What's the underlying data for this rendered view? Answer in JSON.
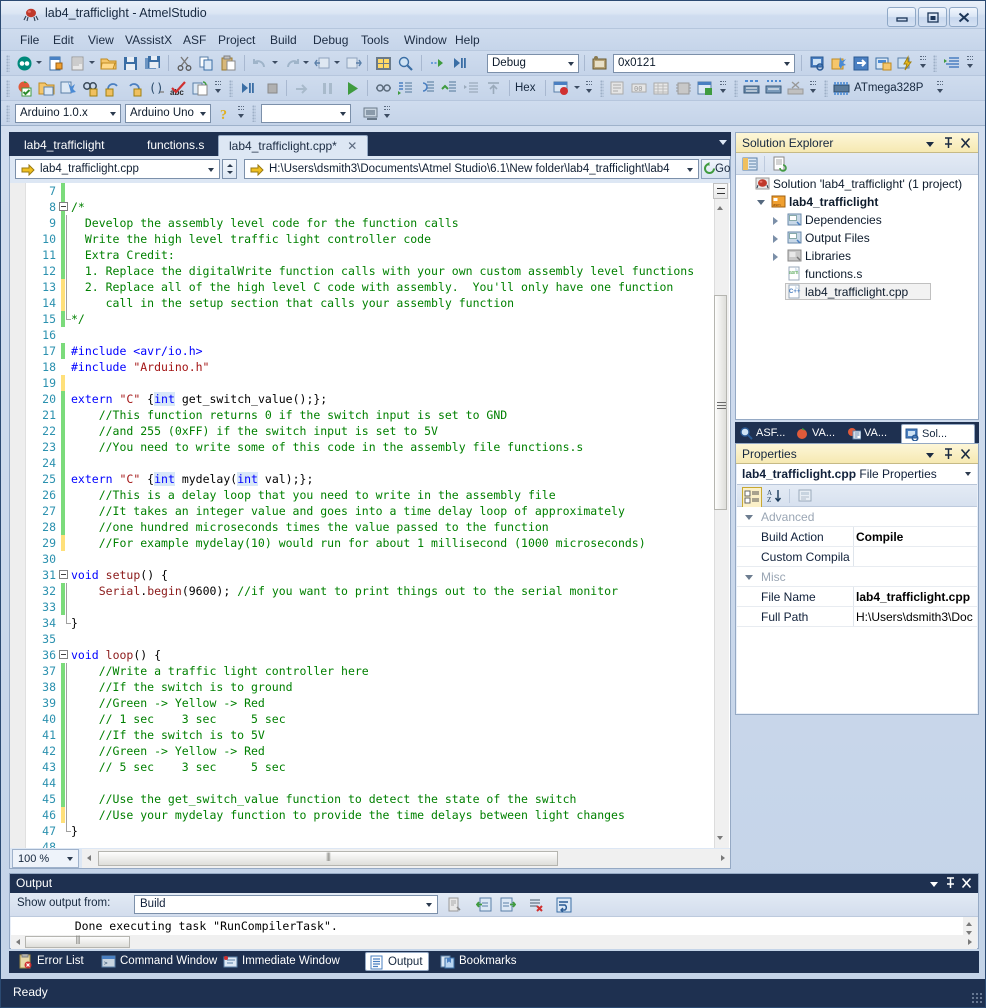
{
  "window": {
    "title": "lab4_trafficlight - AtmelStudio",
    "minimize_label": "Minimize",
    "maximize_label": "Maximize",
    "close_label": "Close"
  },
  "menubar": {
    "items": [
      "File",
      "Edit",
      "View",
      "VAssistX",
      "ASF",
      "Project",
      "Build",
      "Debug",
      "Tools",
      "Window",
      "Help"
    ]
  },
  "toolbar": {
    "debug_config": "Debug",
    "address_value": "0x0121",
    "hex_label": "Hex",
    "device_label": "ATmega328P",
    "arduino_board_version": "Arduino 1.0.x",
    "arduino_board": "Arduino Uno",
    "arduino_port": ""
  },
  "doctabs": {
    "tabs": [
      {
        "label": "lab4_trafficlight",
        "active": false,
        "closable": false
      },
      {
        "label": "functions.s",
        "active": false,
        "closable": false
      },
      {
        "label": "lab4_trafficlight.cpp*",
        "active": true,
        "closable": true
      }
    ],
    "close_glyph": "✕"
  },
  "navbar": {
    "file_combo": "lab4_trafficlight.cpp",
    "path_combo": "H:\\Users\\dsmith3\\Documents\\Atmel Studio\\6.1\\New folder\\lab4_trafficlight\\lab4",
    "go_label": "Go"
  },
  "editor": {
    "zoom": "100 %",
    "lines": [
      {
        "n": 7,
        "marker": "green",
        "fold": "",
        "tokens": []
      },
      {
        "n": 8,
        "marker": "green",
        "fold": "start",
        "tokens": [
          {
            "t": "/*",
            "c": "cmt"
          }
        ]
      },
      {
        "n": 9,
        "marker": "green",
        "fold": "bar",
        "tokens": [
          {
            "t": "  Develop the assembly level code for the function calls",
            "c": "cmt"
          }
        ]
      },
      {
        "n": 10,
        "marker": "green",
        "fold": "bar",
        "tokens": [
          {
            "t": "  Write the high level traffic light controller code",
            "c": "cmt"
          }
        ]
      },
      {
        "n": 11,
        "marker": "green",
        "fold": "bar",
        "tokens": [
          {
            "t": "  Extra Credit:",
            "c": "cmt"
          }
        ]
      },
      {
        "n": 12,
        "marker": "green",
        "fold": "bar",
        "tokens": [
          {
            "t": "  1. Replace the digitalWrite function calls with your own custom assembly level functions",
            "c": "cmt"
          }
        ]
      },
      {
        "n": 13,
        "marker": "yellow",
        "fold": "bar",
        "tokens": [
          {
            "t": "  2. Replace all of the high level C code with assembly.  You'll only have one function",
            "c": "cmt"
          }
        ]
      },
      {
        "n": 14,
        "marker": "yellow",
        "fold": "bar",
        "tokens": [
          {
            "t": "     call in the setup section that calls your assembly function",
            "c": "cmt"
          }
        ]
      },
      {
        "n": 15,
        "marker": "green",
        "fold": "end",
        "tokens": [
          {
            "t": "*/",
            "c": "cmt"
          }
        ]
      },
      {
        "n": 16,
        "marker": "",
        "fold": "",
        "tokens": []
      },
      {
        "n": 17,
        "marker": "green",
        "fold": "",
        "tokens": [
          {
            "t": "#include <avr/io.h>",
            "c": "pp"
          }
        ]
      },
      {
        "n": 18,
        "marker": "",
        "fold": "",
        "tokens": [
          {
            "t": "#include ",
            "c": "pp"
          },
          {
            "t": "\"Arduino.h\"",
            "c": "str"
          }
        ]
      },
      {
        "n": 19,
        "marker": "yellow",
        "fold": "",
        "tokens": []
      },
      {
        "n": 20,
        "marker": "green",
        "fold": "",
        "tokens": [
          {
            "t": "extern ",
            "c": "kw"
          },
          {
            "t": "\"C\"",
            "c": "str"
          },
          {
            "t": " {",
            "c": "pln"
          },
          {
            "t": "int",
            "c": "kw",
            "hl": true
          },
          {
            "t": " get_switch_value();};",
            "c": "pln"
          }
        ]
      },
      {
        "n": 21,
        "marker": "green",
        "fold": "",
        "tokens": [
          {
            "t": "    //This function returns 0 if the switch input is set to GND",
            "c": "cmt"
          }
        ]
      },
      {
        "n": 22,
        "marker": "green",
        "fold": "",
        "tokens": [
          {
            "t": "    //and 255 (0xFF) if the switch input is set to 5V",
            "c": "cmt"
          }
        ]
      },
      {
        "n": 23,
        "marker": "green",
        "fold": "",
        "tokens": [
          {
            "t": "    //You need to write some of this code in the assembly file functions.s",
            "c": "cmt"
          }
        ]
      },
      {
        "n": 24,
        "marker": "green",
        "fold": "",
        "tokens": []
      },
      {
        "n": 25,
        "marker": "green",
        "fold": "",
        "tokens": [
          {
            "t": "extern ",
            "c": "kw"
          },
          {
            "t": "\"C\"",
            "c": "str"
          },
          {
            "t": " {",
            "c": "pln"
          },
          {
            "t": "int",
            "c": "kw",
            "hl": true
          },
          {
            "t": " mydelay(",
            "c": "pln"
          },
          {
            "t": "int",
            "c": "kw",
            "hl": true
          },
          {
            "t": " val);};",
            "c": "pln"
          }
        ]
      },
      {
        "n": 26,
        "marker": "green",
        "fold": "",
        "tokens": [
          {
            "t": "    //This is a delay loop that you need to write in the assembly file",
            "c": "cmt"
          }
        ]
      },
      {
        "n": 27,
        "marker": "green",
        "fold": "",
        "tokens": [
          {
            "t": "    //It takes an integer value and goes into a time delay loop of approximately",
            "c": "cmt"
          }
        ]
      },
      {
        "n": 28,
        "marker": "green",
        "fold": "",
        "tokens": [
          {
            "t": "    //one hundred microseconds times the value passed to the function",
            "c": "cmt"
          }
        ]
      },
      {
        "n": 29,
        "marker": "yellow",
        "fold": "",
        "tokens": [
          {
            "t": "    //For example mydelay(10) would run for about 1 millisecond (1000 microseconds)",
            "c": "cmt"
          }
        ]
      },
      {
        "n": 30,
        "marker": "",
        "fold": "",
        "tokens": []
      },
      {
        "n": 31,
        "marker": "",
        "fold": "start",
        "tokens": [
          {
            "t": "void",
            "c": "kw"
          },
          {
            "t": " ",
            "c": "pln"
          },
          {
            "t": "setup",
            "c": "fn"
          },
          {
            "t": "() {",
            "c": "pln"
          }
        ]
      },
      {
        "n": 32,
        "marker": "green",
        "fold": "bar",
        "tokens": [
          {
            "t": "    ",
            "c": "pln"
          },
          {
            "t": "Serial",
            "c": "fn"
          },
          {
            "t": ".",
            "c": "pln"
          },
          {
            "t": "begin",
            "c": "fn"
          },
          {
            "t": "(9600); ",
            "c": "pln"
          },
          {
            "t": "//if you want to print things out to the serial monitor",
            "c": "cmt"
          }
        ]
      },
      {
        "n": 33,
        "marker": "green",
        "fold": "bar",
        "tokens": []
      },
      {
        "n": 34,
        "marker": "",
        "fold": "end",
        "tokens": [
          {
            "t": "}",
            "c": "pln"
          }
        ]
      },
      {
        "n": 35,
        "marker": "",
        "fold": "",
        "tokens": []
      },
      {
        "n": 36,
        "marker": "",
        "fold": "start",
        "tokens": [
          {
            "t": "void",
            "c": "kw"
          },
          {
            "t": " ",
            "c": "pln"
          },
          {
            "t": "loop",
            "c": "fn"
          },
          {
            "t": "() {",
            "c": "pln"
          }
        ]
      },
      {
        "n": 37,
        "marker": "green",
        "fold": "bar",
        "tokens": [
          {
            "t": "    //Write a traffic light controller here",
            "c": "cmt"
          }
        ]
      },
      {
        "n": 38,
        "marker": "green",
        "fold": "bar",
        "tokens": [
          {
            "t": "    //If the switch is to ground",
            "c": "cmt"
          }
        ]
      },
      {
        "n": 39,
        "marker": "green",
        "fold": "bar",
        "tokens": [
          {
            "t": "    //Green -> Yellow -> Red",
            "c": "cmt"
          }
        ]
      },
      {
        "n": 40,
        "marker": "green",
        "fold": "bar",
        "tokens": [
          {
            "t": "    // 1 sec    3 sec     5 sec",
            "c": "cmt"
          }
        ]
      },
      {
        "n": 41,
        "marker": "green",
        "fold": "bar",
        "tokens": [
          {
            "t": "    //If the switch is to 5V",
            "c": "cmt"
          }
        ]
      },
      {
        "n": 42,
        "marker": "green",
        "fold": "bar",
        "tokens": [
          {
            "t": "    //Green -> Yellow -> Red",
            "c": "cmt"
          }
        ]
      },
      {
        "n": 43,
        "marker": "green",
        "fold": "bar",
        "tokens": [
          {
            "t": "    // 5 sec    3 sec     5 sec",
            "c": "cmt"
          }
        ]
      },
      {
        "n": 44,
        "marker": "green",
        "fold": "bar",
        "tokens": []
      },
      {
        "n": 45,
        "marker": "green",
        "fold": "bar",
        "tokens": [
          {
            "t": "    //Use the get_switch_value function to detect the state of the switch",
            "c": "cmt"
          }
        ]
      },
      {
        "n": 46,
        "marker": "yellow",
        "fold": "bar",
        "tokens": [
          {
            "t": "    //Use your mydelay function to provide the time delays between light changes",
            "c": "cmt"
          }
        ]
      },
      {
        "n": 47,
        "marker": "",
        "fold": "end",
        "tokens": [
          {
            "t": "}",
            "c": "pln"
          }
        ]
      },
      {
        "n": 48,
        "marker": "",
        "fold": "",
        "tokens": []
      }
    ]
  },
  "solution_explorer": {
    "title": "Solution Explorer",
    "tree": [
      {
        "label": "Solution 'lab4_trafficlight' (1 project)",
        "indent": 0,
        "icon": "solution-icon",
        "expander": "",
        "bold": false,
        "selected": false
      },
      {
        "label": "lab4_trafficlight",
        "indent": 1,
        "icon": "project-icon",
        "expander": "open",
        "bold": true,
        "selected": false
      },
      {
        "label": "Dependencies",
        "indent": 2,
        "icon": "folder-ref-icon",
        "expander": "closed",
        "bold": false,
        "selected": false
      },
      {
        "label": "Output Files",
        "indent": 2,
        "icon": "folder-ref-icon",
        "expander": "closed",
        "bold": false,
        "selected": false
      },
      {
        "label": "Libraries",
        "indent": 2,
        "icon": "library-icon",
        "expander": "closed",
        "bold": false,
        "selected": false
      },
      {
        "label": "functions.s",
        "indent": 2,
        "icon": "asm-file-icon",
        "expander": "",
        "bold": false,
        "selected": false
      },
      {
        "label": "lab4_trafficlight.cpp",
        "indent": 2,
        "icon": "cpp-file-icon",
        "expander": "",
        "bold": false,
        "selected": true
      }
    ]
  },
  "right_tabs": {
    "tabs": [
      {
        "label": "ASF...",
        "icon": "asf-icon",
        "active": false
      },
      {
        "label": "VA...",
        "icon": "va-tomato-icon",
        "active": false
      },
      {
        "label": "VA...",
        "icon": "va-outline-icon",
        "active": false
      },
      {
        "label": "Sol...",
        "icon": "solution-explorer-icon",
        "active": true
      }
    ]
  },
  "properties": {
    "title": "Properties",
    "object_name": "lab4_trafficlight.cpp",
    "object_kind": "File Properties",
    "rows": [
      {
        "type": "category",
        "name": "Advanced",
        "value": ""
      },
      {
        "type": "prop",
        "name": "Build Action",
        "value": "Compile",
        "bold_value": true,
        "gray_value": false
      },
      {
        "type": "prop",
        "name": "Custom Compila",
        "value": "",
        "bold_value": false,
        "gray_value": false
      },
      {
        "type": "category",
        "name": "Misc",
        "value": ""
      },
      {
        "type": "prop",
        "name": "File Name",
        "value": "lab4_trafficlight.cpp",
        "bold_value": true,
        "gray_value": false
      },
      {
        "type": "prop",
        "name": "Full Path",
        "value": "H:\\Users\\dsmith3\\Doc",
        "bold_value": false,
        "gray_value": true
      }
    ]
  },
  "output": {
    "title": "Output",
    "show_output_from_label": "Show output from:",
    "source": "Build",
    "text": "    Done executing task \"RunCompilerTask\"."
  },
  "dock_tabs": {
    "tabs": [
      {
        "label": "Error List",
        "icon": "error-list-icon",
        "active": false
      },
      {
        "label": "Command Window",
        "icon": "command-window-icon",
        "active": false
      },
      {
        "label": "Immediate Window",
        "icon": "immediate-window-icon",
        "active": false
      },
      {
        "label": "Output",
        "icon": "output-icon",
        "active": true
      },
      {
        "label": "Bookmarks",
        "icon": "bookmarks-icon",
        "active": false
      }
    ]
  },
  "statusbar": {
    "text": "Ready"
  },
  "colors": {
    "chrome_blue": "#1e3050",
    "toolbar_bg": "#cfdcee",
    "panel_header": "#f6e9b2",
    "comment_green": "#008000",
    "keyword_blue": "#0000ff",
    "string_red": "#a31515",
    "line_number": "#2b91af",
    "change_green": "#7bdb7b",
    "change_yellow": "#ffe07a"
  }
}
